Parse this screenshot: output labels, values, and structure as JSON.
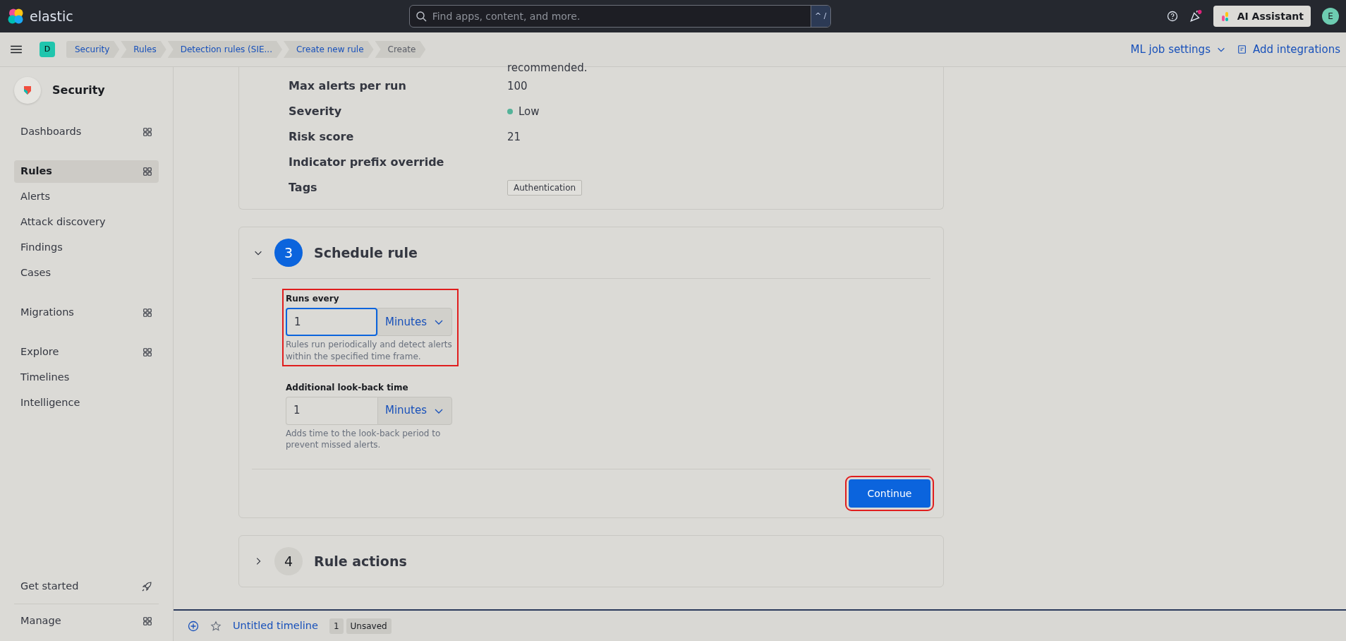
{
  "header": {
    "logo": "elastic",
    "search": {
      "placeholder": "Find apps, content, and more.",
      "shortcut": "^ /"
    },
    "ai_button": "AI Assistant",
    "avatar": "E",
    "news_unread": true
  },
  "space": "D",
  "breadcrumbs": [
    {
      "label": "Security",
      "selected": false
    },
    {
      "label": "Rules",
      "selected": false
    },
    {
      "label": "Detection rules (SIE...",
      "selected": false
    },
    {
      "label": "Create new rule",
      "selected": false
    },
    {
      "label": "Create",
      "selected": true
    }
  ],
  "header_links": [
    {
      "label": "ML job settings",
      "kind": "dropdown"
    },
    {
      "label": "Add integrations",
      "kind": "add"
    }
  ],
  "sidebar": {
    "title": "Security",
    "groups": [
      [
        {
          "label": "Dashboards",
          "selected": false,
          "kind": "section"
        }
      ],
      [
        {
          "label": "Rules",
          "selected": true,
          "kind": "section"
        },
        {
          "label": "Alerts",
          "selected": false,
          "kind": "link"
        },
        {
          "label": "Attack discovery",
          "selected": false,
          "kind": "link"
        },
        {
          "label": "Findings",
          "selected": false,
          "kind": "link"
        },
        {
          "label": "Cases",
          "selected": false,
          "kind": "link"
        }
      ],
      [
        {
          "label": "Migrations",
          "selected": false,
          "kind": "section"
        }
      ],
      [
        {
          "label": "Explore",
          "selected": false,
          "kind": "section"
        },
        {
          "label": "Timelines",
          "selected": false,
          "kind": "link"
        },
        {
          "label": "Intelligence",
          "selected": false,
          "kind": "link"
        }
      ]
    ],
    "footer": [
      {
        "label": "Get started",
        "kind": "launch"
      },
      {
        "label": "Manage",
        "kind": "section"
      }
    ]
  },
  "about": {
    "cut_text": "recommended.",
    "rows": [
      {
        "label": "Max alerts per run",
        "kind": "text",
        "value": "100"
      },
      {
        "label": "Severity",
        "kind": "severity",
        "value": "Low",
        "color": "#54b399"
      },
      {
        "label": "Risk score",
        "kind": "text",
        "value": "21"
      },
      {
        "label": "Indicator prefix override",
        "kind": "text"
      },
      {
        "label": "Tags",
        "kind": "tags",
        "tags": [
          "Authentication"
        ]
      }
    ]
  },
  "steps": [
    {
      "number": "3",
      "title": "Schedule rule",
      "expanded": true,
      "fields": [
        {
          "label": "Runs every",
          "value": "1",
          "unit": "Minutes",
          "help": "Rules run periodically and detect alerts within the specified time frame.",
          "focused": true,
          "highlighted": true
        },
        {
          "label": "Additional look-back time",
          "value": "1",
          "unit": "Minutes",
          "help": "Adds time to the look-back period to prevent missed alerts.",
          "focused": false,
          "highlighted": false
        }
      ],
      "button": {
        "label": "Continue",
        "highlighted": true
      }
    },
    {
      "number": "4",
      "title": "Rule actions",
      "expanded": false
    }
  ],
  "timeline": {
    "title": "Untitled timeline",
    "count": "1",
    "status": "Unsaved"
  }
}
